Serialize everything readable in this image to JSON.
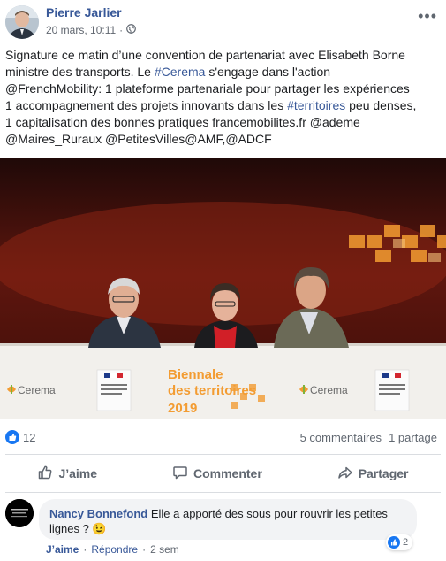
{
  "post": {
    "author": "Pierre Jarlier",
    "date": "20 mars, 10:11",
    "separator": "·",
    "privacy_icon": "globe-icon",
    "more_label": "•••",
    "text_segments": [
      [
        {
          "t": "Signature ce matin d’une convention de partenariat avec Elisabeth Borne"
        }
      ],
      [
        {
          "t": "ministre des transports. Le "
        },
        {
          "t": "#Cerema",
          "tag": true
        },
        {
          "t": " s'engage dans l'action"
        }
      ],
      [
        {
          "t": "@FrenchMobility: 1 plateforme partenariale pour partager les expériences"
        }
      ],
      [
        {
          "t": "1 accompagnement des projets innovants dans les "
        },
        {
          "t": "#territoires",
          "tag": true
        },
        {
          "t": " peu denses,"
        }
      ],
      [
        {
          "t": "1 capitalisation des bonnes pratiques francemobilites.fr @ademe"
        }
      ],
      [
        {
          "t": "@Maires_Ruraux @PetitesVilles@AMF,@ADCF"
        }
      ]
    ],
    "photo": {
      "banner_line1": "Biennale",
      "banner_line2": "des territoires",
      "banner_year": "2019",
      "logo_left": "Cerema",
      "logo_right": "Cerema",
      "ministry_text": "MINISTÈRE DE LA TRANSITION ÉCOLOGIQUE ET SOLIDAIRE"
    }
  },
  "stats": {
    "like_count": "12",
    "comments": "5 commentaires",
    "shares": "1 partage"
  },
  "actions": {
    "like": "J’aime",
    "comment": "Commenter",
    "share": "Partager"
  },
  "comment": {
    "author": "Nancy Bonnefond",
    "text_line1": " Elle a apporté des sous pour rouvrir les petites",
    "text_line2": "lignes ? 😉",
    "reaction_count": "2",
    "like_link": "J’aime",
    "reply_link": "Répondre",
    "time": "2 sem",
    "sep": "·"
  },
  "colors": {
    "link_blue": "#385898",
    "facebook_blue": "#1877f2",
    "banner_orange": "#f39c32",
    "stage_red": "#7a1a10"
  }
}
